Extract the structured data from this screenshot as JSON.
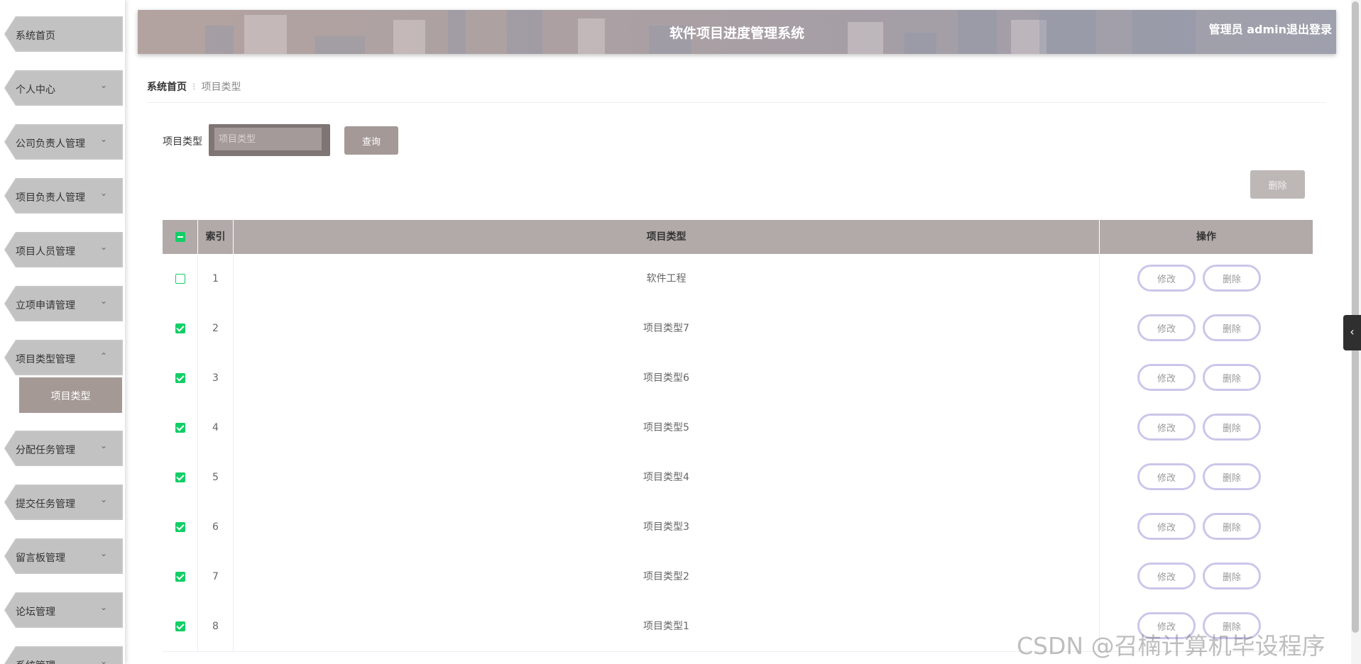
{
  "sidebar": {
    "items": [
      {
        "label": "系统首页",
        "expandable": false
      },
      {
        "label": "个人中心",
        "expandable": true
      },
      {
        "label": "公司负责人管理",
        "expandable": true
      },
      {
        "label": "项目负责人管理",
        "expandable": true
      },
      {
        "label": "项目人员管理",
        "expandable": true
      },
      {
        "label": "立项申请管理",
        "expandable": true
      },
      {
        "label": "项目类型管理",
        "expandable": true,
        "expanded": true
      },
      {
        "label": "分配任务管理",
        "expandable": true
      },
      {
        "label": "提交任务管理",
        "expandable": true
      },
      {
        "label": "留言板管理",
        "expandable": true
      },
      {
        "label": "论坛管理",
        "expandable": true
      },
      {
        "label": "系统管理",
        "expandable": true
      }
    ],
    "submenu": {
      "label": "项目类型"
    }
  },
  "header": {
    "title": "软件项目进度管理系统",
    "user": "管理员 admin",
    "logout": "退出登录"
  },
  "breadcrumb": {
    "home": "系统首页",
    "current": "项目类型"
  },
  "search": {
    "label": "项目类型",
    "placeholder": "项目类型",
    "query_button": "查询"
  },
  "toolbar": {
    "delete_button": "删除"
  },
  "table": {
    "columns": [
      "索引",
      "项目类型",
      "操作"
    ],
    "rows": [
      {
        "index": "1",
        "type": "软件工程",
        "checked": false
      },
      {
        "index": "2",
        "type": "项目类型7",
        "checked": true
      },
      {
        "index": "3",
        "type": "项目类型6",
        "checked": true
      },
      {
        "index": "4",
        "type": "项目类型5",
        "checked": true
      },
      {
        "index": "5",
        "type": "项目类型4",
        "checked": true
      },
      {
        "index": "6",
        "type": "项目类型3",
        "checked": true
      },
      {
        "index": "7",
        "type": "项目类型2",
        "checked": true
      },
      {
        "index": "8",
        "type": "项目类型1",
        "checked": true
      }
    ],
    "edit_label": "修改",
    "delete_label": "删除",
    "select_all_state": "indeterminate"
  },
  "icons": {
    "chevron_down": "chevron-down-icon",
    "chevron_up": "chevron-up-icon",
    "side_tab": "chevron-left-icon"
  },
  "watermark": "CSDN @召楠计算机毕设程序",
  "colors": {
    "accent": "#a49997",
    "checkbox": "#13ce66",
    "button_border": "#cbc6ea"
  }
}
